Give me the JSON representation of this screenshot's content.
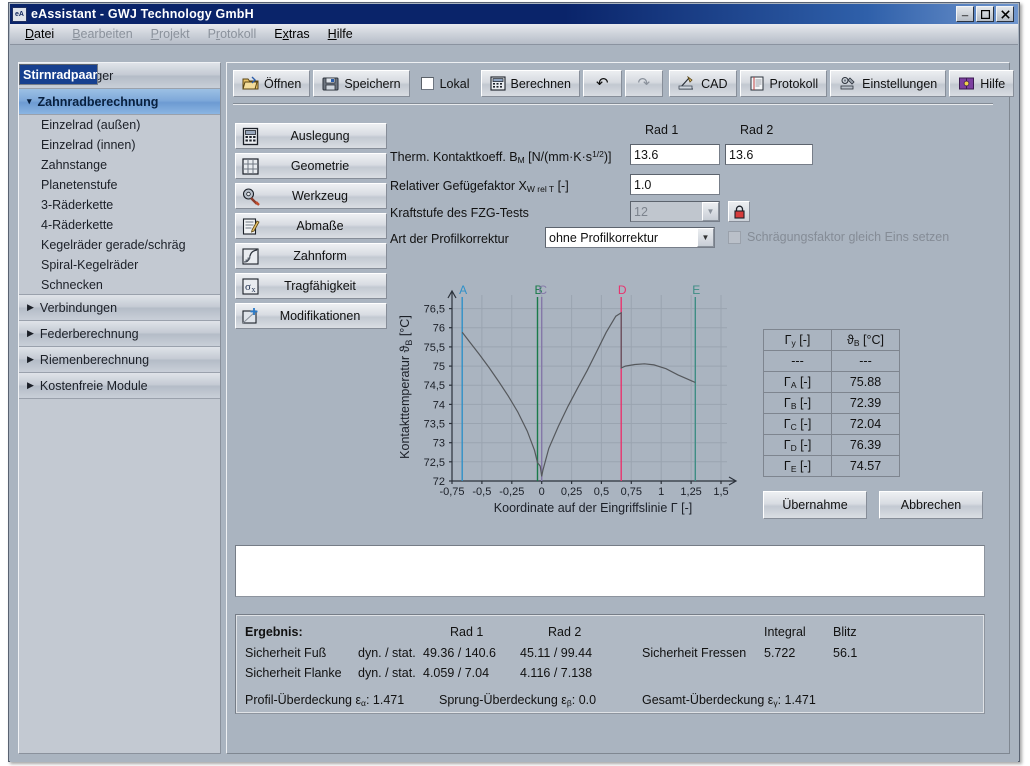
{
  "window": {
    "title": "eAssistant - GWJ Technology GmbH",
    "icon": "eA",
    "minimize": "_",
    "maximize": "□",
    "close": "✕"
  },
  "menubar": [
    {
      "label": "Datei",
      "accel": "D",
      "disabled": false
    },
    {
      "label": "Bearbeiten",
      "accel": "B",
      "disabled": true
    },
    {
      "label": "Projekt",
      "accel": "P",
      "disabled": true
    },
    {
      "label": "Protokoll",
      "accel": "r",
      "disabled": true
    },
    {
      "label": "Extras",
      "accel": "x",
      "disabled": false
    },
    {
      "label": "Hilfe",
      "accel": "H",
      "disabled": false
    }
  ],
  "sidebar": {
    "groups": [
      {
        "label": "Welle / Lager",
        "open": false,
        "tri": "▶",
        "items": []
      },
      {
        "label": "Zahnradberechnung",
        "open": true,
        "tri": "◢",
        "items": [
          {
            "label": "Einzelrad (außen)",
            "selected": false
          },
          {
            "label": "Einzelrad (innen)",
            "selected": false
          },
          {
            "label": "Zahnstange",
            "selected": false
          },
          {
            "label": "Stirnradpaar",
            "selected": true
          },
          {
            "label": "Planetenstufe",
            "selected": false
          },
          {
            "label": "3-Räderkette",
            "selected": false
          },
          {
            "label": "4-Räderkette",
            "selected": false
          },
          {
            "label": "Kegelräder gerade/schräg",
            "selected": false
          },
          {
            "label": "Spiral-Kegelräder",
            "selected": false
          },
          {
            "label": "Schnecken",
            "selected": false
          }
        ]
      },
      {
        "label": "Verbindungen",
        "open": false,
        "tri": "▶",
        "items": []
      },
      {
        "label": "Federberechnung",
        "open": false,
        "tri": "▶",
        "items": []
      },
      {
        "label": "Riemenberechnung",
        "open": false,
        "tri": "▶",
        "items": []
      },
      {
        "label": "Kostenfreie Module",
        "open": false,
        "tri": "▶",
        "items": []
      }
    ]
  },
  "toolbar": {
    "open_label": "Öffnen",
    "save_label": "Speichern",
    "local_label": "Lokal",
    "local_checked": false,
    "calc_label": "Berechnen",
    "undo_label": "↶",
    "redo_label": "↷",
    "cad_label": "CAD",
    "protocol_label": "Protokoll",
    "settings_label": "Einstellungen",
    "help_label": "Hilfe"
  },
  "tabs": [
    {
      "label": "Auslegung",
      "icon": "calculator-icon"
    },
    {
      "label": "Geometrie",
      "icon": "grid-icon"
    },
    {
      "label": "Werkzeug",
      "icon": "gear-tool-icon"
    },
    {
      "label": "Abmaße",
      "icon": "ruler-pencil-icon"
    },
    {
      "label": "Zahnform",
      "icon": "tooth-profile-icon"
    },
    {
      "label": "Tragfähigkeit",
      "icon": "sigma-x-icon"
    },
    {
      "label": "Modifikationen",
      "icon": "modification-icon"
    }
  ],
  "form": {
    "col1_header": "Rad 1",
    "col2_header": "Rad 2",
    "therm_label_a": "Therm. Kontaktkoeff. B",
    "therm_label_sub": "M",
    "therm_label_b": " [N/(mm·K·s",
    "therm_label_sup": "1/2",
    "therm_label_c": ")]",
    "therm_rad1": "13.6",
    "therm_rad2": "13.6",
    "gefuege_label_a": "Relativer Gefügefaktor X",
    "gefuege_label_sub": "W rel T",
    "gefuege_label_b": " [-]",
    "gefuege_value": "1.0",
    "fzg_label": "Kraftstufe des FZG-Tests",
    "fzg_value": "12",
    "fzg_disabled": true,
    "lock_icon": "lock-icon",
    "profil_label": "Art der Profilkorrektur",
    "profil_value": "ohne Profilkorrektur",
    "schraeg_label": "Schrägungsfaktor gleich Eins setzen",
    "schraeg_checked": false,
    "schraeg_disabled": true
  },
  "chart_data": {
    "type": "line",
    "title": "",
    "xlabel": "Koordinate auf der Eingriffslinie Γ [-]",
    "ylabel": "Kontakttemperatur ϑ_B [°C]",
    "xlim": [
      -0.75,
      1.5
    ],
    "ylim": [
      72,
      76.75
    ],
    "xticks": [
      "-0,75",
      "-0,5",
      "-0,25",
      "0",
      "0,25",
      "0,5",
      "0,75",
      "1",
      "1,25",
      "1,5"
    ],
    "xtick_values": [
      -0.75,
      -0.5,
      -0.25,
      0,
      0.25,
      0.5,
      0.75,
      1,
      1.25,
      1.5
    ],
    "yticks": [
      "72",
      "72,5",
      "73",
      "73,5",
      "74",
      "74,5",
      "75",
      "75,5",
      "76",
      "76,5"
    ],
    "ytick_values": [
      72,
      72.5,
      73,
      73.5,
      74,
      74.5,
      75,
      75.5,
      76,
      76.5
    ],
    "grid": true,
    "legend": "none",
    "series": [
      {
        "name": "Kontakttemperatur",
        "color": "#55585c",
        "x": [
          -0.665,
          -0.6,
          -0.52,
          -0.44,
          -0.36,
          -0.28,
          -0.2,
          -0.12,
          -0.06,
          -0.035,
          -0.012,
          0.0,
          0.01,
          0.06,
          0.14,
          0.22,
          0.3,
          0.38,
          0.46,
          0.54,
          0.62,
          0.665,
          0.665,
          0.7,
          0.78,
          0.86,
          0.94,
          1.04,
          1.14,
          1.22,
          1.285
        ],
        "y": [
          75.88,
          75.62,
          75.3,
          74.96,
          74.6,
          74.22,
          73.8,
          73.3,
          72.8,
          72.48,
          72.39,
          72.12,
          72.28,
          72.85,
          73.43,
          73.95,
          74.42,
          74.88,
          75.38,
          75.88,
          76.3,
          76.39,
          74.95,
          75.0,
          75.04,
          75.06,
          75.03,
          74.93,
          74.77,
          74.66,
          74.57
        ]
      }
    ],
    "markers": [
      {
        "label": "A",
        "x": -0.665,
        "color": "#2f90c8"
      },
      {
        "label": "B",
        "x": -0.035,
        "color": "#1a7a4a"
      },
      {
        "label": "C",
        "x": 0.0,
        "color": "#8478a8"
      },
      {
        "label": "D",
        "x": 0.665,
        "color": "#e8336e"
      },
      {
        "label": "E",
        "x": 1.285,
        "color": "#3f8d84"
      }
    ]
  },
  "side_table": {
    "headers": [
      "Γy [-]",
      "ϑB [°C]"
    ],
    "header_html": [
      {
        "base": "Γ",
        "sub": "y",
        "tail": " [-]"
      },
      {
        "base": "ϑ",
        "sub": "B",
        "tail": " [°C]"
      }
    ],
    "rows": [
      {
        "label_base": "",
        "label_sub": "",
        "label_tail": "---",
        "value": "---"
      },
      {
        "label_base": "Γ",
        "label_sub": "A",
        "label_tail": " [-]",
        "value": "75.88"
      },
      {
        "label_base": "Γ",
        "label_sub": "B",
        "label_tail": " [-]",
        "value": "72.39"
      },
      {
        "label_base": "Γ",
        "label_sub": "C",
        "label_tail": " [-]",
        "value": "72.04"
      },
      {
        "label_base": "Γ",
        "label_sub": "D",
        "label_tail": " [-]",
        "value": "76.39"
      },
      {
        "label_base": "Γ",
        "label_sub": "E",
        "label_tail": " [-]",
        "value": "74.57"
      }
    ]
  },
  "actions": {
    "accept_label": "Übernahme",
    "cancel_label": "Abbrechen"
  },
  "message_box": {
    "text": ""
  },
  "result": {
    "title": "Ergebnis:",
    "col_rad1": "Rad 1",
    "col_rad2": "Rad 2",
    "col_integral": "Integral",
    "col_blitz": "Blitz",
    "row_fuss_label": "Sicherheit Fuß",
    "row_fuss_mode": "dyn. / stat.",
    "row_fuss_rad1": "49.36  / 140.6",
    "row_fuss_rad2": "45.11  / 99.44",
    "row_flanke_label": "Sicherheit Flanke",
    "row_flanke_mode": "dyn. / stat.",
    "row_flanke_rad1": "4.059  / 7.04",
    "row_flanke_rad2": "4.116  / 7.138",
    "fressen_label": "Sicherheit Fressen",
    "fressen_integral": "5.722",
    "fressen_blitz": "56.1",
    "profil_ueb_a": "Profil-Überdeckung ε",
    "profil_ueb_sub": "α",
    "profil_ueb_val": ": 1.471",
    "sprung_ueb_a": "Sprung-Überdeckung ε",
    "sprung_ueb_sub": "β",
    "sprung_ueb_val": ": 0.0",
    "gesamt_ueb_a": "Gesamt-Überdeckung ε",
    "gesamt_ueb_sub": "γ",
    "gesamt_ueb_val": ": 1.471"
  }
}
